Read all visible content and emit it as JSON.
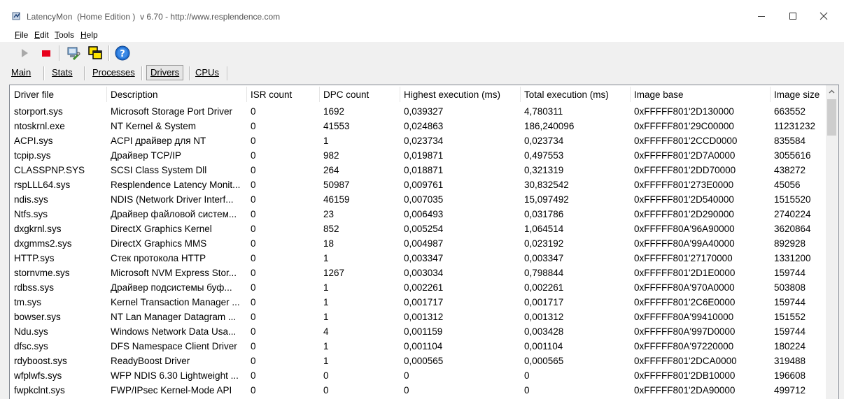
{
  "window": {
    "title": "LatencyMon  (Home Edition )  v 6.70 - http://www.resplendence.com"
  },
  "menu": [
    {
      "key": "F",
      "rest": "ile"
    },
    {
      "key": "E",
      "rest": "dit"
    },
    {
      "key": "T",
      "rest": "ools"
    },
    {
      "key": "H",
      "rest": "elp"
    }
  ],
  "toolbar": {
    "play_icon": "play-icon",
    "stop_icon": "stop-icon",
    "stop_color": "#e8001c",
    "tool1_icon": "computer-wrench-icon",
    "tool2_icon": "windows-overlap-icon",
    "help_icon": "help-icon"
  },
  "tabs": [
    "Main",
    "Stats",
    "Processes",
    "Drivers",
    "CPUs"
  ],
  "active_tab": "Drivers",
  "columns": [
    "Driver file",
    "Description",
    "ISR count",
    "DPC count",
    "Highest execution (ms)",
    "Total execution (ms)",
    "Image base",
    "Image size"
  ],
  "rows": [
    [
      "storport.sys",
      "Microsoft Storage Port Driver",
      "0",
      "1692",
      "0,039327",
      "4,780311",
      "0xFFFFF801'2D130000",
      "663552"
    ],
    [
      "ntoskrnl.exe",
      "NT Kernel & System",
      "0",
      "41553",
      "0,024863",
      "186,240096",
      "0xFFFFF801'29C00000",
      "11231232"
    ],
    [
      "ACPI.sys",
      "ACPI драйвер для NT",
      "0",
      "1",
      "0,023734",
      "0,023734",
      "0xFFFFF801'2CCD0000",
      "835584"
    ],
    [
      "tcpip.sys",
      "Драйвер TCP/IP",
      "0",
      "982",
      "0,019871",
      "0,497553",
      "0xFFFFF801'2D7A0000",
      "3055616"
    ],
    [
      "CLASSPNP.SYS",
      "SCSI Class System Dll",
      "0",
      "264",
      "0,018871",
      "0,321319",
      "0xFFFFF801'2DD70000",
      "438272"
    ],
    [
      "rspLLL64.sys",
      "Resplendence Latency Monit...",
      "0",
      "50987",
      "0,009761",
      "30,832542",
      "0xFFFFF801'273E0000",
      "45056"
    ],
    [
      "ndis.sys",
      "NDIS (Network Driver Interf...",
      "0",
      "46159",
      "0,007035",
      "15,097492",
      "0xFFFFF801'2D540000",
      "1515520"
    ],
    [
      "Ntfs.sys",
      "Драйвер файловой систем...",
      "0",
      "23",
      "0,006493",
      "0,031786",
      "0xFFFFF801'2D290000",
      "2740224"
    ],
    [
      "dxgkrnl.sys",
      "DirectX Graphics Kernel",
      "0",
      "852",
      "0,005254",
      "1,064514",
      "0xFFFFF80A'96A90000",
      "3620864"
    ],
    [
      "dxgmms2.sys",
      "DirectX Graphics MMS",
      "0",
      "18",
      "0,004987",
      "0,023192",
      "0xFFFFF80A'99A40000",
      "892928"
    ],
    [
      "HTTP.sys",
      "Стек протокола HTTP",
      "0",
      "1",
      "0,003347",
      "0,003347",
      "0xFFFFF801'27170000",
      "1331200"
    ],
    [
      "stornvme.sys",
      "Microsoft NVM Express Stor...",
      "0",
      "1267",
      "0,003034",
      "0,798844",
      "0xFFFFF801'2D1E0000",
      "159744"
    ],
    [
      "rdbss.sys",
      "Драйвер подсистемы буф...",
      "0",
      "1",
      "0,002261",
      "0,002261",
      "0xFFFFF80A'970A0000",
      "503808"
    ],
    [
      "tm.sys",
      "Kernel Transaction Manager ...",
      "0",
      "1",
      "0,001717",
      "0,001717",
      "0xFFFFF801'2C6E0000",
      "159744"
    ],
    [
      "bowser.sys",
      "NT Lan Manager Datagram ...",
      "0",
      "1",
      "0,001312",
      "0,001312",
      "0xFFFFF80A'99410000",
      "151552"
    ],
    [
      "Ndu.sys",
      "Windows Network Data Usa...",
      "0",
      "4",
      "0,001159",
      "0,003428",
      "0xFFFFF80A'997D0000",
      "159744"
    ],
    [
      "dfsc.sys",
      "DFS Namespace Client Driver",
      "0",
      "1",
      "0,001104",
      "0,001104",
      "0xFFFFF80A'97220000",
      "180224"
    ],
    [
      "rdyboost.sys",
      "ReadyBoost Driver",
      "0",
      "1",
      "0,000565",
      "0,000565",
      "0xFFFFF801'2DCA0000",
      "319488"
    ],
    [
      "wfplwfs.sys",
      "WFP NDIS 6.30 Lightweight ...",
      "0",
      "0",
      "0",
      "0",
      "0xFFFFF801'2DB10000",
      "196608"
    ],
    [
      "fwpkclnt.sys",
      "FWP/IPsec Kernel-Mode API",
      "0",
      "0",
      "0",
      "0",
      "0xFFFFF801'2DA90000",
      "499712"
    ]
  ]
}
